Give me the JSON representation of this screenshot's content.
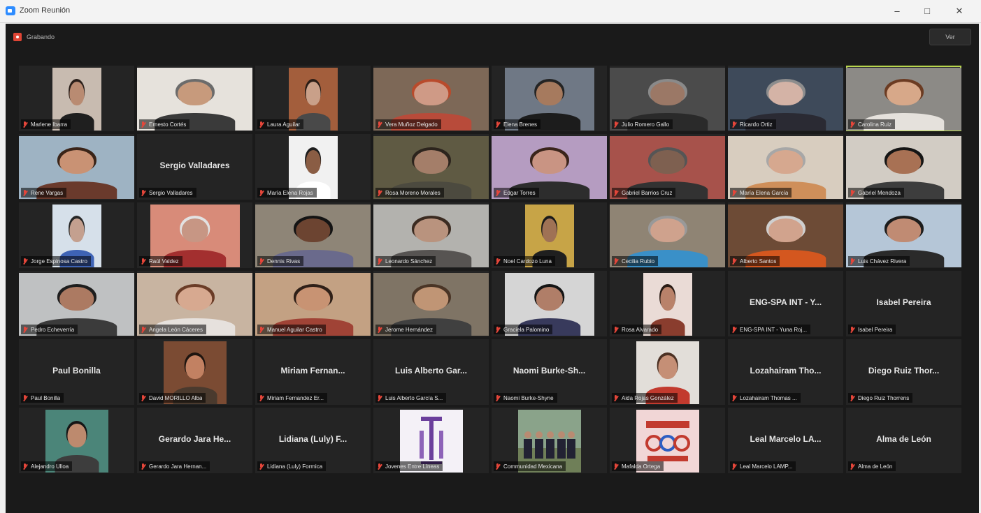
{
  "window": {
    "title": "Zoom Reunión",
    "minimize": "–",
    "maximize": "□",
    "close": "✕",
    "icon": "zoom-app-icon"
  },
  "toolbar": {
    "recording_label": "Grabando",
    "view_label": "Ver"
  },
  "participants": [
    {
      "label": "Marlene Ibarra",
      "video": {
        "w": 70,
        "bg": "#c8bbb0",
        "skin": "#b98b72",
        "shirt": "#1f1f1f",
        "hair": "#2a1f1a"
      }
    },
    {
      "label": "Ernesto Cortés",
      "video": {
        "w": 165,
        "bg": "#e6e2dc",
        "skin": "#c79a7c",
        "shirt": "#3a3a3a",
        "hair": "#6b6b6b"
      }
    },
    {
      "label": "Laura Aguilar",
      "video": {
        "w": 70,
        "bg": "#a35e3c",
        "skin": "#c9a089",
        "shirt": "#494949",
        "hair": "#2b1d16"
      }
    },
    {
      "label": "Vera Muñoz Delgado",
      "video": {
        "w": 165,
        "bg": "#7d6857",
        "skin": "#cf9a86",
        "shirt": "#b84b3a",
        "hair": "#b94b2c"
      }
    },
    {
      "label": "Elena Brenes",
      "video": {
        "w": 128,
        "bg": "#6f7885",
        "skin": "#a67a5e",
        "shirt": "#1c1c1c",
        "hair": "#242424"
      }
    },
    {
      "label": "Julio Romero Gallo",
      "video": {
        "w": 165,
        "bg": "#4b4b4b",
        "skin": "#9b7866",
        "shirt": "#2a2a2a",
        "hair": "#8a8a8a"
      }
    },
    {
      "label": "Ricardo Ortiz",
      "video": {
        "w": 165,
        "bg": "#3e4a5a",
        "skin": "#d4b3a6",
        "shirt": "#2a2a33",
        "hair": "#8d8d8d"
      }
    },
    {
      "label": "Carolina Ruiz",
      "active": true,
      "video": {
        "w": 165,
        "bg": "#8c8a86",
        "skin": "#d7a889",
        "shirt": "#e5e1dc",
        "hair": "#6b3b22"
      }
    },
    {
      "label": "Rene Vargas",
      "video": {
        "w": 165,
        "bg": "#9eb3c3",
        "skin": "#c99274",
        "shirt": "#6a3a2c",
        "hair": "#3a2418"
      }
    },
    {
      "label": "Sergio Valladares",
      "name_text": "Sergio Valladares"
    },
    {
      "label": "María Elena Rojas",
      "video": {
        "w": 70,
        "bg": "#f1f1f1",
        "skin": "#8a5d44",
        "shirt": "#ffffff",
        "hair": "#1d1d1d"
      }
    },
    {
      "label": "Rosa Moreno Morales",
      "video": {
        "w": 165,
        "bg": "#5f5a43",
        "skin": "#a47e69",
        "shirt": "#4c4a3f",
        "hair": "#2c241d"
      }
    },
    {
      "label": "Edgar Torres",
      "video": {
        "w": 165,
        "bg": "#b59cc1",
        "skin": "#c99483",
        "shirt": "#2d2d2d",
        "hair": "#3a241b"
      }
    },
    {
      "label": "Gabriel Barrios Cruz",
      "video": {
        "w": 165,
        "bg": "#a7524b",
        "skin": "#7e6050",
        "shirt": "#323232",
        "hair": "#555555"
      }
    },
    {
      "label": "María Elena García",
      "video": {
        "w": 165,
        "bg": "#d8cdbf",
        "skin": "#d6a88f",
        "shirt": "#cf8f5a",
        "hair": "#a7a7a7"
      }
    },
    {
      "label": "Gabriel Mendoza",
      "video": {
        "w": 165,
        "bg": "#d2ccc4",
        "skin": "#a87154",
        "shirt": "#3d3d3d",
        "hair": "#151515"
      }
    },
    {
      "label": "Jorge Espinosa Castro",
      "video": {
        "w": 70,
        "bg": "#d6e0ea",
        "skin": "#c4a08f",
        "shirt": "#3e63b5",
        "hair": "#262626"
      }
    },
    {
      "label": "Raúl Valdez",
      "video": {
        "w": 128,
        "bg": "#d88b79",
        "skin": "#c79684",
        "shirt": "#a32f2f",
        "hair": "#e2e2e2"
      }
    },
    {
      "label": "Dennis Rivas",
      "video": {
        "w": 165,
        "bg": "#8e8577",
        "skin": "#6c4431",
        "shirt": "#6a6a8c",
        "hair": "#141414"
      }
    },
    {
      "label": "Leonardo Sánchez",
      "video": {
        "w": 165,
        "bg": "#b3b2ae",
        "skin": "#b9937e",
        "shirt": "#575452",
        "hair": "#3b2b21"
      }
    },
    {
      "label": "Noel Cardozo Luna",
      "video": {
        "w": 70,
        "bg": "#c7a447",
        "skin": "#9f7255",
        "shirt": "#1f1f1f",
        "hair": "#1a1a1a"
      }
    },
    {
      "label": "Cecilia Rubio",
      "video": {
        "w": 165,
        "bg": "#8f8474",
        "skin": "#cfa28d",
        "shirt": "#3a90c8",
        "hair": "#999999"
      }
    },
    {
      "label": "Alberto Santos",
      "video": {
        "w": 165,
        "bg": "#6d4b36",
        "skin": "#d1a38d",
        "shirt": "#d4571f",
        "hair": "#cfcfcf"
      }
    },
    {
      "label": "Luis Chávez Rivera",
      "video": {
        "w": 165,
        "bg": "#b5c6d7",
        "skin": "#c08b73",
        "shirt": "#2a2a2a",
        "hair": "#1c1c1c"
      }
    },
    {
      "label": "Pedro Echeverría",
      "video": {
        "w": 165,
        "bg": "#bfc1c2",
        "skin": "#ac7a62",
        "shirt": "#3b3b3b",
        "hair": "#1e1e1e"
      }
    },
    {
      "label": "Angela León Cáceres",
      "video": {
        "w": 165,
        "bg": "#c8b4a1",
        "skin": "#d7a990",
        "shirt": "#e6e1dd",
        "hair": "#6a3c27"
      }
    },
    {
      "label": "Manuel Aguilar Castro",
      "video": {
        "w": 165,
        "bg": "#c3a183",
        "skin": "#c89373",
        "shirt": "#a04336",
        "hair": "#2f2018"
      }
    },
    {
      "label": "Jerome Hernández",
      "video": {
        "w": 165,
        "bg": "#7f7465",
        "skin": "#c09575",
        "shirt": "#404040",
        "hair": "#4a3526"
      }
    },
    {
      "label": "Graciela Palomino",
      "video": {
        "w": 128,
        "bg": "#d5d5d5",
        "skin": "#b07e68",
        "shirt": "#383a5c",
        "hair": "#151515"
      }
    },
    {
      "label": "Rosa Alvarado",
      "video": {
        "w": 70,
        "bg": "#eadbd6",
        "skin": "#b9826a",
        "shirt": "#8a3d2e",
        "hair": "#2a1c15"
      }
    },
    {
      "label": "ENG-SPA INT - Yuna Roj...",
      "name_text": "ENG-SPA INT - Y..."
    },
    {
      "label": "Isabel Pereira",
      "name_text": "Isabel Pereira"
    },
    {
      "label": "Paul Bonilla",
      "name_text": "Paul Bonilla"
    },
    {
      "label": "David MORILLO Alba",
      "video": {
        "w": 90,
        "bg": "#7b4b33",
        "skin": "#c28162",
        "shirt": "#4a3a2e",
        "hair": "#1e1510"
      }
    },
    {
      "label": "Miriam Fernandez Er...",
      "name_text": "Miriam Fernan..."
    },
    {
      "label": "Luis Alberto García S...",
      "name_text": "Luis Alberto Gar..."
    },
    {
      "label": "Naomi Burke-Shyne",
      "name_text": "Naomi Burke-Sh..."
    },
    {
      "label": "Aida Rojas González",
      "video": {
        "w": 90,
        "bg": "#e2ded9",
        "skin": "#c58f76",
        "shirt": "#c23a2e",
        "hair": "#4c3124"
      }
    },
    {
      "label": "Lozahairam Thomas ...",
      "name_text": "Lozahairam Tho..."
    },
    {
      "label": "Diego Ruiz Thorrens",
      "name_text": "Diego Ruiz Thor..."
    },
    {
      "label": "Alejandro Ulloa",
      "video": {
        "w": 90,
        "bg": "#4b8579",
        "skin": "#bd8a6e",
        "shirt": "#3d3d3d",
        "hair": "#151515"
      }
    },
    {
      "label": "Gerardo Jara Hernan...",
      "name_text": "Gerardo Jara He..."
    },
    {
      "label": "Lidiana (Luly) Formica",
      "name_text": "Lidiana (Luly) F..."
    },
    {
      "label": "Jovenes Entre Líneas",
      "logo": "purple-logo",
      "video": {
        "w": 90,
        "bg": "#f4f1f7"
      }
    },
    {
      "label": "Communidad Mexicana",
      "logo": "group-photo",
      "video": {
        "w": 90,
        "bg": "#8aa38a"
      }
    },
    {
      "label": "Mafalda Ortega",
      "logo": "red-text-logo",
      "video": {
        "w": 90,
        "bg": "#f1d6d6"
      }
    },
    {
      "label": "Leal Marcelo LAMP...",
      "name_text": "Leal Marcelo LA..."
    },
    {
      "label": "Alma de León",
      "name_text": "Alma de León"
    }
  ]
}
